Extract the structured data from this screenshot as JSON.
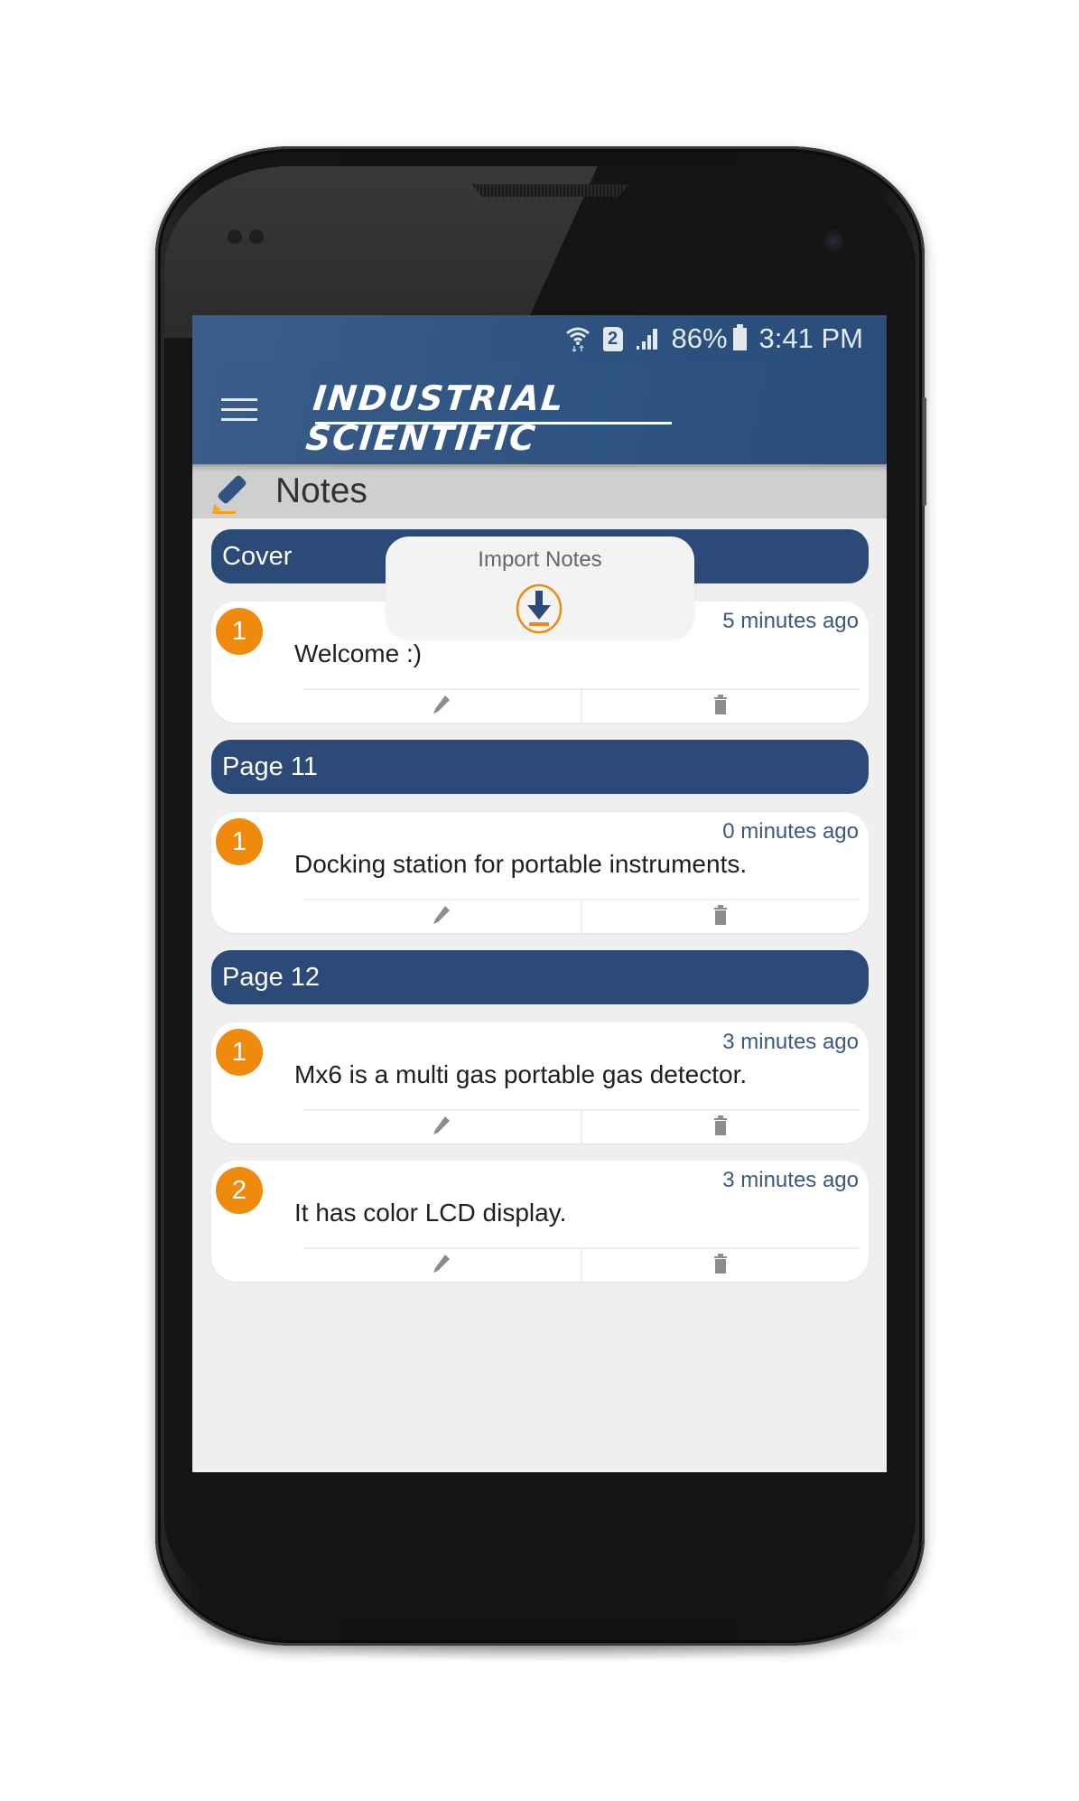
{
  "status_bar": {
    "wifi_icon": "wifi-data-icon",
    "sim_label": "2",
    "signal_icon": "cell-signal-icon",
    "battery_percent": "86%",
    "battery_icon": "battery-icon",
    "time": "3:41 PM"
  },
  "app_bar": {
    "menu_icon": "hamburger-menu-icon",
    "logo_line1": "INDUSTRIAL",
    "logo_line2": "SCIENTIFIC"
  },
  "section": {
    "icon": "pencil-icon",
    "title": "Notes"
  },
  "import_popup": {
    "label": "Import Notes",
    "icon": "download-icon"
  },
  "colors": {
    "primary": "#2b4a77",
    "accent": "#f08a0c",
    "timestamp": "#3d5880"
  },
  "groups": [
    {
      "title": "Cover",
      "notes": [
        {
          "number": "1",
          "time": "5 minutes ago",
          "text": "Welcome :)"
        }
      ]
    },
    {
      "title": "Page 11",
      "notes": [
        {
          "number": "1",
          "time": "0 minutes ago",
          "text": "Docking station for portable instruments."
        }
      ]
    },
    {
      "title": "Page 12",
      "notes": [
        {
          "number": "1",
          "time": "3 minutes ago",
          "text": "Mx6 is a multi gas portable gas detector."
        },
        {
          "number": "2",
          "time": "3 minutes ago",
          "text": "It has color LCD display."
        }
      ]
    }
  ]
}
